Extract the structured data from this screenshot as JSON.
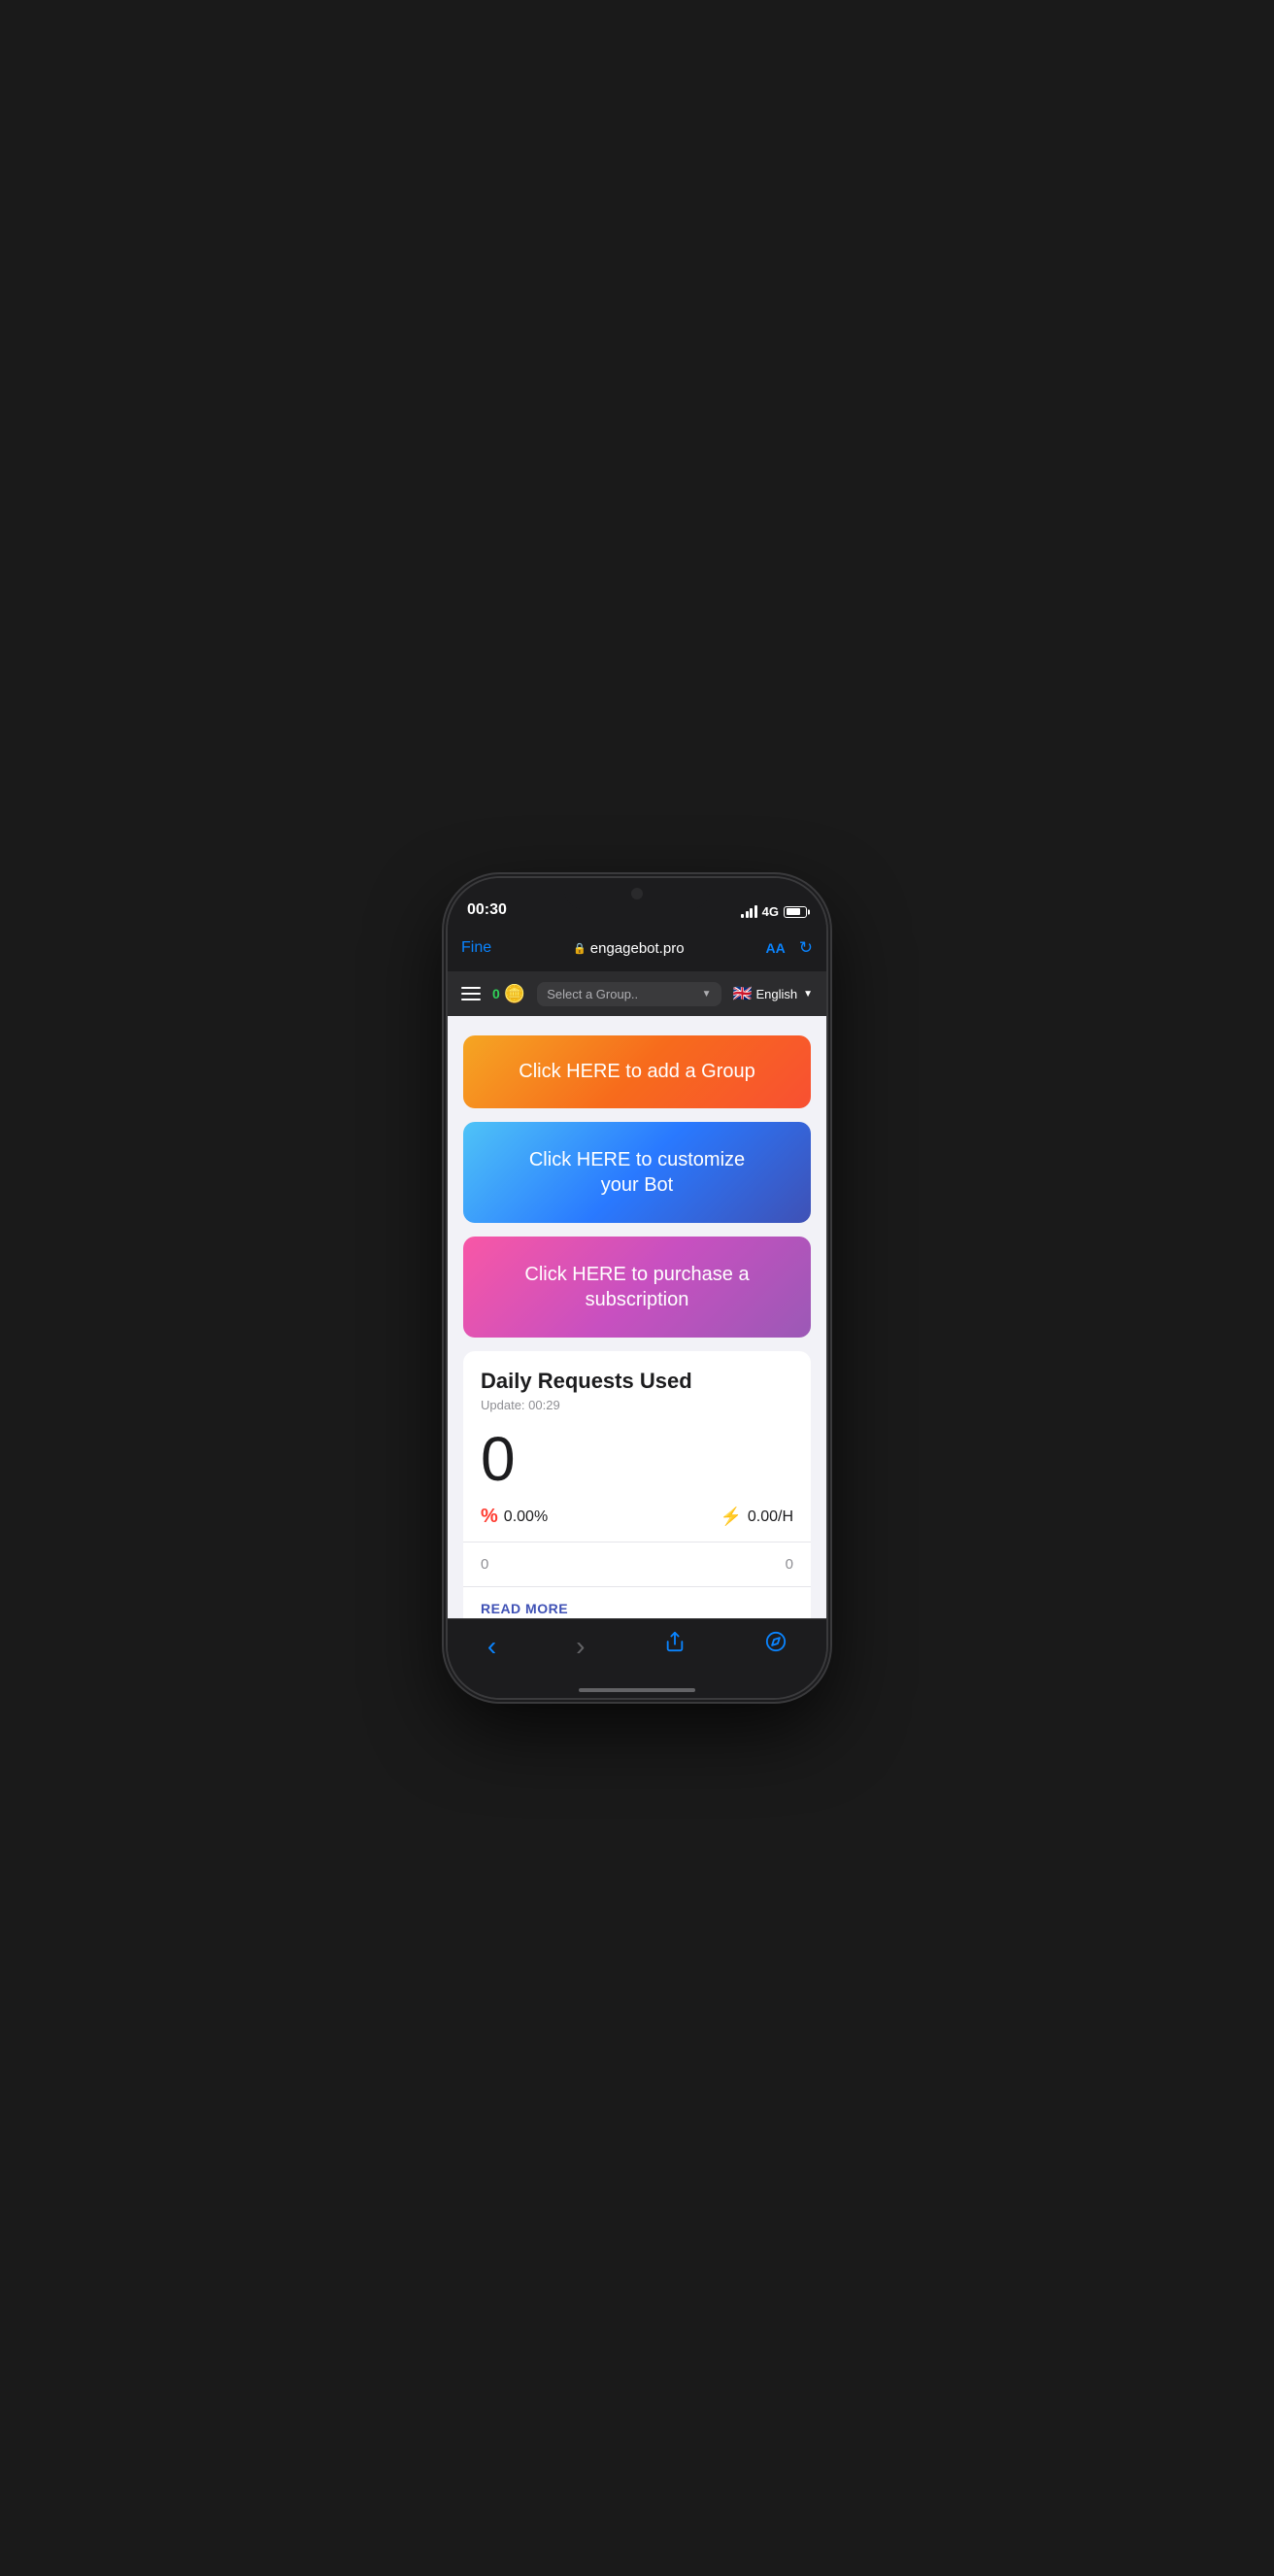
{
  "status_bar": {
    "time": "00:30",
    "network_type": "4G"
  },
  "browser": {
    "back_label": "Fine",
    "url": "engagebot.pro",
    "aa_label": "AA",
    "refresh_symbol": "↻"
  },
  "nav": {
    "coin_count": "0",
    "group_placeholder": "Select a Group..",
    "lang_flag": "🇬🇧",
    "lang_label": "English"
  },
  "buttons": {
    "add_group": "Click HERE to add a Group",
    "customize_bot": "Click HERE to customize\nyour Bot",
    "purchase": "Click HERE to purchase a\nsubscription"
  },
  "stats": {
    "title": "Daily Requests Used",
    "update_label": "Update: 00:29",
    "count": "0",
    "percent": "0.00%",
    "rate": "0.00/H",
    "bottom_left": "0",
    "bottom_right": "0",
    "read_more": "READ MORE"
  },
  "bottom_nav": {
    "back": "‹",
    "forward": "›",
    "share": "⬆",
    "bookmark": "⊕"
  }
}
